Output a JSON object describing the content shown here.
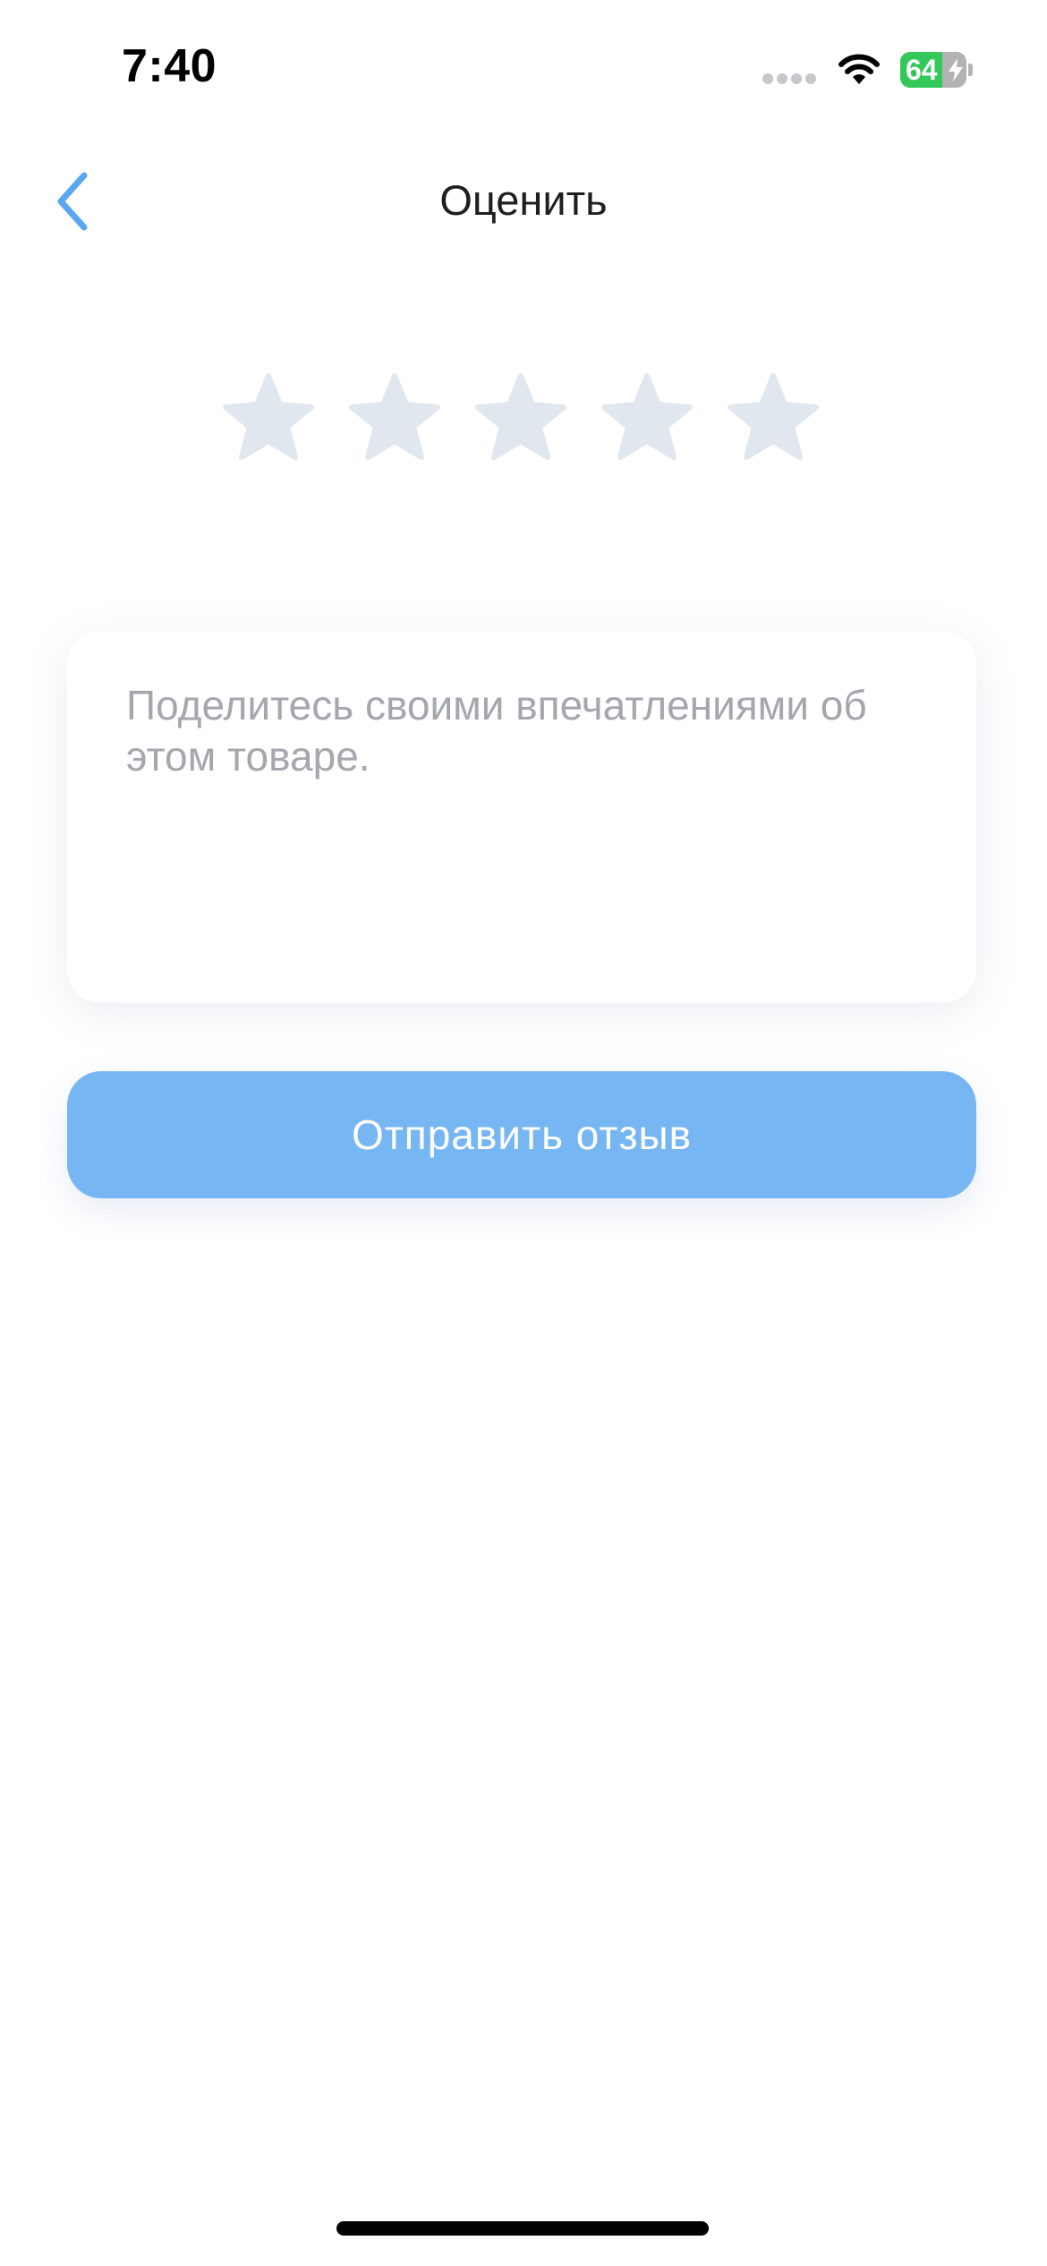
{
  "status_bar": {
    "time": "7:40",
    "battery_level": "64",
    "battery_fraction": 0.64,
    "battery_charging": true,
    "icons": [
      "signal-icon",
      "wifi-icon",
      "battery-icon",
      "charging-bolt-icon"
    ]
  },
  "nav": {
    "title": "Оценить",
    "back_icon": "chevron-left-icon"
  },
  "rating": {
    "max": 5,
    "value": 0,
    "star_icon": "star-icon"
  },
  "review": {
    "value": "",
    "placeholder": "Поделитесь своими впечатлениями об этом товаре."
  },
  "submit": {
    "label": "Отправить отзыв"
  },
  "colors": {
    "accent": "#76b6f2",
    "back_icon": "#5aa7ef",
    "star_empty": "#e1e7ee",
    "placeholder": "#a4a7ad",
    "battery": "#34c759"
  }
}
